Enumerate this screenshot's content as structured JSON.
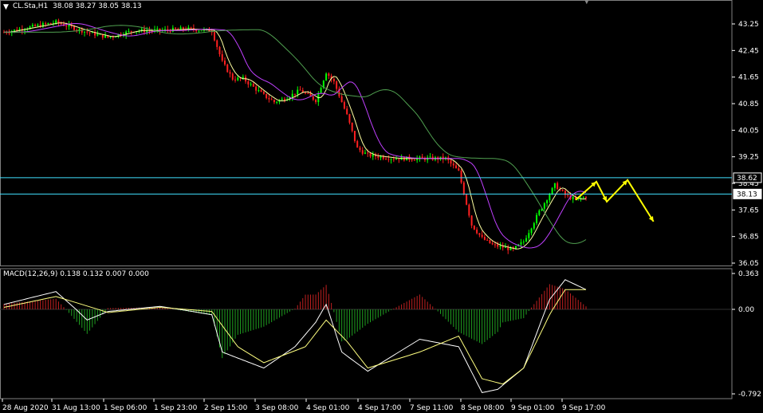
{
  "price_panel": {
    "symbol_label": "CL.Sta,H1",
    "ohlc_label": "38.08 38.27 38.05 38.13",
    "y_ticks": [
      "43.25",
      "42.45",
      "41.65",
      "40.85",
      "40.05",
      "39.25",
      "38.45",
      "37.65",
      "36.85",
      "36.05"
    ],
    "level_tags": [
      "38.62",
      "38.13"
    ]
  },
  "macd_panel": {
    "label": "MACD(12,26,9) 0.138 0.132 0.007 0.000",
    "y_ticks": [
      "0.363",
      "0.00",
      "-0.792"
    ]
  },
  "x_ticks": [
    "28 Aug 2020",
    "31 Aug 13:00",
    "1 Sep 06:00",
    "1 Sep 23:00",
    "2 Sep 15:00",
    "3 Sep 08:00",
    "4 Sep 01:00",
    "4 Sep 17:00",
    "7 Sep 11:00",
    "8 Sep 08:00",
    "9 Sep 01:00",
    "9 Sep 17:00"
  ],
  "colors": {
    "background": "#000000",
    "up_candle": "#00ff00",
    "down_candle": "#ff2020",
    "ma_fast": "#ffffa0",
    "ma_mid": "#c040ff",
    "ma_slow": "#50a050",
    "level_line": "#40e0ff",
    "forecast_arrow": "#ffff00",
    "macd_hist_pos": "#c02020",
    "macd_hist_neg": "#20a020",
    "macd_line": "#ffffff",
    "signal_line": "#ffff80"
  },
  "chart_data": [
    {
      "type": "candlestick",
      "title": "CL.Sta,H1",
      "ylim": [
        36.05,
        43.6
      ],
      "horizontal_levels": [
        38.62,
        38.13
      ],
      "x_tick_labels": [
        "28 Aug 2020",
        "31 Aug 13:00",
        "1 Sep 06:00",
        "1 Sep 23:00",
        "2 Sep 15:00",
        "3 Sep 08:00",
        "4 Sep 01:00",
        "4 Sep 17:00",
        "7 Sep 11:00",
        "8 Sep 08:00",
        "9 Sep 01:00",
        "9 Sep 17:00"
      ],
      "close_path_approx": [
        [
          0,
          43.0
        ],
        [
          1,
          43.3
        ],
        [
          1.6,
          43.0
        ],
        [
          2,
          42.85
        ],
        [
          2.5,
          43.05
        ],
        [
          3,
          43.05
        ],
        [
          3.5,
          43.1
        ],
        [
          4,
          43.05
        ],
        [
          4.2,
          42.1
        ],
        [
          4.4,
          41.6
        ],
        [
          4.6,
          41.6
        ],
        [
          5,
          41.1
        ],
        [
          5.2,
          40.9
        ],
        [
          5.4,
          41.0
        ],
        [
          5.7,
          41.25
        ],
        [
          6,
          40.95
        ],
        [
          6.2,
          41.8
        ],
        [
          6.35,
          41.5
        ],
        [
          6.6,
          40.5
        ],
        [
          6.8,
          39.5
        ],
        [
          7,
          39.3
        ],
        [
          7.5,
          39.2
        ],
        [
          8,
          39.2
        ],
        [
          8.5,
          39.2
        ],
        [
          8.75,
          38.8
        ],
        [
          9,
          37.2
        ],
        [
          9.2,
          36.8
        ],
        [
          9.4,
          36.6
        ],
        [
          9.8,
          36.45
        ],
        [
          10,
          36.7
        ],
        [
          10.3,
          37.6
        ],
        [
          10.6,
          38.4
        ],
        [
          10.8,
          38.1
        ],
        [
          11,
          37.95
        ],
        [
          11.2,
          38.05
        ]
      ],
      "forecast_path_approx": [
        [
          11,
          37.95
        ],
        [
          11.4,
          38.5
        ],
        [
          11.6,
          37.9
        ],
        [
          12,
          38.55
        ],
        [
          12.5,
          37.3
        ]
      ]
    },
    {
      "type": "macd",
      "title": "MACD(12,26,9) 0.138 0.132 0.007 0.000",
      "params": [
        12,
        26,
        9
      ],
      "ylim": [
        -0.792,
        0.363
      ],
      "macd_path_approx": [
        [
          0,
          0.05
        ],
        [
          1,
          0.18
        ],
        [
          1.6,
          -0.1
        ],
        [
          2,
          -0.02
        ],
        [
          3,
          0.03
        ],
        [
          4,
          -0.05
        ],
        [
          4.2,
          -0.4
        ],
        [
          5,
          -0.55
        ],
        [
          5.6,
          -0.35
        ],
        [
          6,
          -0.12
        ],
        [
          6.2,
          0.05
        ],
        [
          6.5,
          -0.4
        ],
        [
          7,
          -0.58
        ],
        [
          8,
          -0.28
        ],
        [
          8.75,
          -0.35
        ],
        [
          9.2,
          -0.78
        ],
        [
          9.5,
          -0.75
        ],
        [
          10,
          -0.55
        ],
        [
          10.5,
          0.1
        ],
        [
          10.8,
          0.3
        ],
        [
          11.2,
          0.2
        ]
      ],
      "signal_path_approx": [
        [
          0,
          0.02
        ],
        [
          1,
          0.13
        ],
        [
          2,
          -0.03
        ],
        [
          3,
          0.02
        ],
        [
          4,
          -0.02
        ],
        [
          4.5,
          -0.35
        ],
        [
          5,
          -0.5
        ],
        [
          5.8,
          -0.35
        ],
        [
          6.2,
          -0.1
        ],
        [
          6.6,
          -0.3
        ],
        [
          7,
          -0.55
        ],
        [
          8,
          -0.4
        ],
        [
          8.75,
          -0.25
        ],
        [
          9.2,
          -0.65
        ],
        [
          9.6,
          -0.7
        ],
        [
          10,
          -0.55
        ],
        [
          10.5,
          -0.05
        ],
        [
          10.8,
          0.2
        ],
        [
          11.2,
          0.2
        ]
      ]
    }
  ]
}
